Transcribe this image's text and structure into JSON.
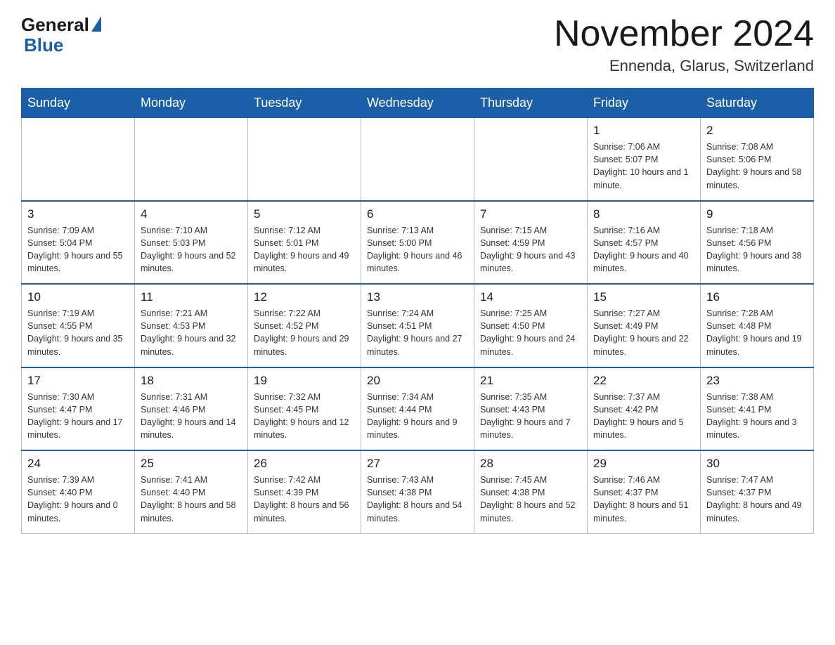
{
  "header": {
    "logo_general": "General",
    "logo_blue": "Blue",
    "month_title": "November 2024",
    "location": "Ennenda, Glarus, Switzerland"
  },
  "weekdays": [
    "Sunday",
    "Monday",
    "Tuesday",
    "Wednesday",
    "Thursday",
    "Friday",
    "Saturday"
  ],
  "weeks": [
    [
      {
        "day": "",
        "info": ""
      },
      {
        "day": "",
        "info": ""
      },
      {
        "day": "",
        "info": ""
      },
      {
        "day": "",
        "info": ""
      },
      {
        "day": "",
        "info": ""
      },
      {
        "day": "1",
        "info": "Sunrise: 7:06 AM\nSunset: 5:07 PM\nDaylight: 10 hours and 1 minute."
      },
      {
        "day": "2",
        "info": "Sunrise: 7:08 AM\nSunset: 5:06 PM\nDaylight: 9 hours and 58 minutes."
      }
    ],
    [
      {
        "day": "3",
        "info": "Sunrise: 7:09 AM\nSunset: 5:04 PM\nDaylight: 9 hours and 55 minutes."
      },
      {
        "day": "4",
        "info": "Sunrise: 7:10 AM\nSunset: 5:03 PM\nDaylight: 9 hours and 52 minutes."
      },
      {
        "day": "5",
        "info": "Sunrise: 7:12 AM\nSunset: 5:01 PM\nDaylight: 9 hours and 49 minutes."
      },
      {
        "day": "6",
        "info": "Sunrise: 7:13 AM\nSunset: 5:00 PM\nDaylight: 9 hours and 46 minutes."
      },
      {
        "day": "7",
        "info": "Sunrise: 7:15 AM\nSunset: 4:59 PM\nDaylight: 9 hours and 43 minutes."
      },
      {
        "day": "8",
        "info": "Sunrise: 7:16 AM\nSunset: 4:57 PM\nDaylight: 9 hours and 40 minutes."
      },
      {
        "day": "9",
        "info": "Sunrise: 7:18 AM\nSunset: 4:56 PM\nDaylight: 9 hours and 38 minutes."
      }
    ],
    [
      {
        "day": "10",
        "info": "Sunrise: 7:19 AM\nSunset: 4:55 PM\nDaylight: 9 hours and 35 minutes."
      },
      {
        "day": "11",
        "info": "Sunrise: 7:21 AM\nSunset: 4:53 PM\nDaylight: 9 hours and 32 minutes."
      },
      {
        "day": "12",
        "info": "Sunrise: 7:22 AM\nSunset: 4:52 PM\nDaylight: 9 hours and 29 minutes."
      },
      {
        "day": "13",
        "info": "Sunrise: 7:24 AM\nSunset: 4:51 PM\nDaylight: 9 hours and 27 minutes."
      },
      {
        "day": "14",
        "info": "Sunrise: 7:25 AM\nSunset: 4:50 PM\nDaylight: 9 hours and 24 minutes."
      },
      {
        "day": "15",
        "info": "Sunrise: 7:27 AM\nSunset: 4:49 PM\nDaylight: 9 hours and 22 minutes."
      },
      {
        "day": "16",
        "info": "Sunrise: 7:28 AM\nSunset: 4:48 PM\nDaylight: 9 hours and 19 minutes."
      }
    ],
    [
      {
        "day": "17",
        "info": "Sunrise: 7:30 AM\nSunset: 4:47 PM\nDaylight: 9 hours and 17 minutes."
      },
      {
        "day": "18",
        "info": "Sunrise: 7:31 AM\nSunset: 4:46 PM\nDaylight: 9 hours and 14 minutes."
      },
      {
        "day": "19",
        "info": "Sunrise: 7:32 AM\nSunset: 4:45 PM\nDaylight: 9 hours and 12 minutes."
      },
      {
        "day": "20",
        "info": "Sunrise: 7:34 AM\nSunset: 4:44 PM\nDaylight: 9 hours and 9 minutes."
      },
      {
        "day": "21",
        "info": "Sunrise: 7:35 AM\nSunset: 4:43 PM\nDaylight: 9 hours and 7 minutes."
      },
      {
        "day": "22",
        "info": "Sunrise: 7:37 AM\nSunset: 4:42 PM\nDaylight: 9 hours and 5 minutes."
      },
      {
        "day": "23",
        "info": "Sunrise: 7:38 AM\nSunset: 4:41 PM\nDaylight: 9 hours and 3 minutes."
      }
    ],
    [
      {
        "day": "24",
        "info": "Sunrise: 7:39 AM\nSunset: 4:40 PM\nDaylight: 9 hours and 0 minutes."
      },
      {
        "day": "25",
        "info": "Sunrise: 7:41 AM\nSunset: 4:40 PM\nDaylight: 8 hours and 58 minutes."
      },
      {
        "day": "26",
        "info": "Sunrise: 7:42 AM\nSunset: 4:39 PM\nDaylight: 8 hours and 56 minutes."
      },
      {
        "day": "27",
        "info": "Sunrise: 7:43 AM\nSunset: 4:38 PM\nDaylight: 8 hours and 54 minutes."
      },
      {
        "day": "28",
        "info": "Sunrise: 7:45 AM\nSunset: 4:38 PM\nDaylight: 8 hours and 52 minutes."
      },
      {
        "day": "29",
        "info": "Sunrise: 7:46 AM\nSunset: 4:37 PM\nDaylight: 8 hours and 51 minutes."
      },
      {
        "day": "30",
        "info": "Sunrise: 7:47 AM\nSunset: 4:37 PM\nDaylight: 8 hours and 49 minutes."
      }
    ]
  ]
}
